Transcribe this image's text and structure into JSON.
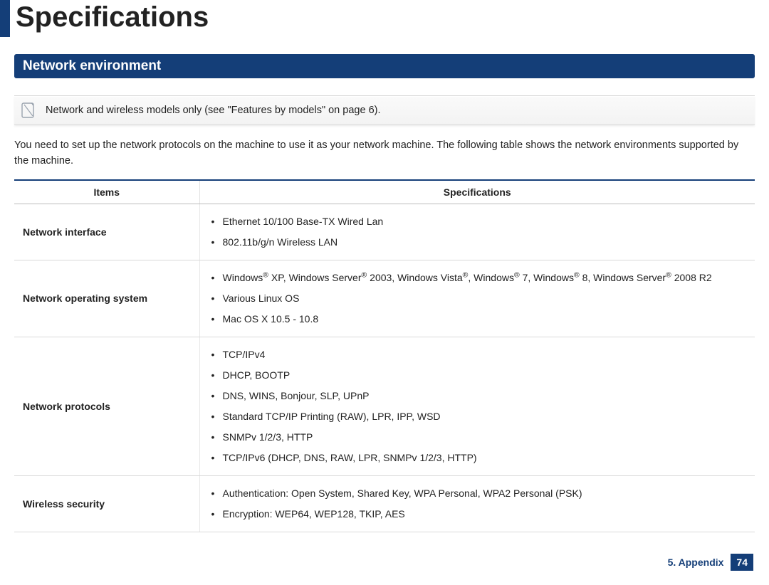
{
  "page_title": "Specifications",
  "section_header": "Network environment",
  "note": "Network and wireless models only (see \"Features by models\" on page 6).",
  "intro": "You need to set up the network protocols on the machine to use it as your network machine. The following table shows the network environments supported by the machine.",
  "table": {
    "headers": {
      "items": "Items",
      "specs": "Specifications"
    },
    "rows": [
      {
        "item": "Network interface",
        "specs": [
          "Ethernet 10/100 Base-TX Wired Lan",
          "802.11b/g/n Wireless LAN"
        ]
      },
      {
        "item": "Network operating system",
        "specs_html": [
          "Windows<span class=\"reg\">®</span> XP, Windows Server<span class=\"reg\">®</span> 2003, Windows Vista<span class=\"reg\">®</span>, Windows<span class=\"reg\">®</span> 7, Windows<span class=\"reg\">®</span> 8, Windows Server<span class=\"reg\">®</span> 2008 R2",
          "Various Linux OS",
          "Mac OS X 10.5 - 10.8"
        ]
      },
      {
        "item": "Network protocols",
        "specs": [
          "TCP/IPv4",
          "DHCP, BOOTP",
          "DNS, WINS, Bonjour, SLP, UPnP",
          "Standard TCP/IP Printing (RAW), LPR, IPP, WSD",
          "SNMPv 1/2/3, HTTP",
          "TCP/IPv6 (DHCP, DNS, RAW, LPR, SNMPv 1/2/3, HTTP)"
        ]
      },
      {
        "item": "Wireless security",
        "specs": [
          "Authentication: Open System, Shared Key, WPA Personal, WPA2 Personal (PSK)",
          "Encryption: WEP64, WEP128, TKIP, AES"
        ]
      }
    ]
  },
  "footer": {
    "chapter": "5. Appendix",
    "page": "74"
  }
}
